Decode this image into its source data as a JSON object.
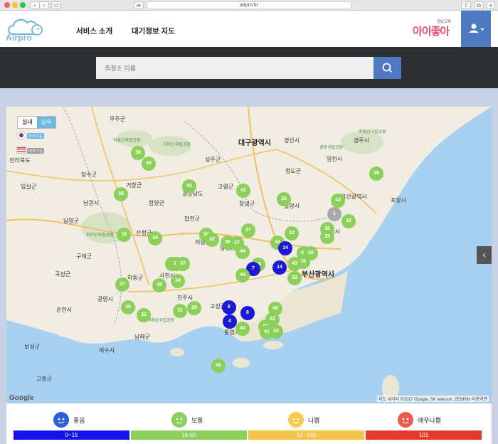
{
  "browser": {
    "url": "airpro.kr"
  },
  "header": {
    "logo_text": "Airpro",
    "nav": [
      "서비스 소개",
      "대기정보 지도"
    ],
    "brand_sub": "경남교육",
    "brand_main": "아이좋아"
  },
  "search": {
    "placeholder": "측정소 이름"
  },
  "map": {
    "tabs": [
      "실내",
      "실외"
    ],
    "active_tab": "실외",
    "time_badges": [
      "한국기준",
      "미국기준"
    ],
    "cities": [
      {
        "name": "대구광역시",
        "big": true
      },
      {
        "name": "부산광역시",
        "big": true
      },
      {
        "name": "울산광역시",
        "big": false
      },
      {
        "name": "경상남도",
        "big": false
      },
      {
        "name": "전라북도",
        "big": false
      },
      {
        "name": "창녕군",
        "big": false
      },
      {
        "name": "경산시",
        "big": false
      },
      {
        "name": "경주시",
        "big": false
      },
      {
        "name": "청도군",
        "big": false
      },
      {
        "name": "밀양시",
        "big": false
      },
      {
        "name": "무주군",
        "big": false
      },
      {
        "name": "장수군",
        "big": false
      },
      {
        "name": "함양군",
        "big": false
      },
      {
        "name": "산청군",
        "big": false
      },
      {
        "name": "구례군",
        "big": false
      },
      {
        "name": "광양시",
        "big": false
      },
      {
        "name": "순천시",
        "big": false
      },
      {
        "name": "여수시",
        "big": false
      },
      {
        "name": "남해군",
        "big": false
      },
      {
        "name": "통영시",
        "big": false
      },
      {
        "name": "고성군",
        "big": false
      },
      {
        "name": "담양군",
        "big": false
      },
      {
        "name": "보성군",
        "big": false
      },
      {
        "name": "고흥군",
        "big": false
      },
      {
        "name": "진주시",
        "big": false
      },
      {
        "name": "사천시",
        "big": false
      },
      {
        "name": "하동군",
        "big": false
      },
      {
        "name": "거창군",
        "big": false
      },
      {
        "name": "합천군",
        "big": false
      },
      {
        "name": "성주군",
        "big": false
      },
      {
        "name": "고령군",
        "big": false
      },
      {
        "name": "의령군",
        "big": false
      },
      {
        "name": "함안군",
        "big": false
      },
      {
        "name": "임실군",
        "big": false
      },
      {
        "name": "남원시",
        "big": false
      },
      {
        "name": "곡성군",
        "big": false
      },
      {
        "name": "양산시",
        "big": false
      },
      {
        "name": "영천시",
        "big": false
      },
      {
        "name": "포항시",
        "big": false
      }
    ],
    "parks": [
      "덕유산국립공원",
      "가야산국립공원",
      "지리산국립공원",
      "한려해상국립공원",
      "경주국립공원",
      "주왕산국립공원"
    ],
    "markers": [
      {
        "v": "38",
        "c": "normal"
      },
      {
        "v": "36",
        "c": "normal"
      },
      {
        "v": "42",
        "c": "normal"
      },
      {
        "v": "38",
        "c": "normal"
      },
      {
        "v": "16",
        "c": "normal"
      },
      {
        "v": "34",
        "c": "normal"
      },
      {
        "v": "42",
        "c": "normal"
      },
      {
        "v": "25",
        "c": "normal"
      },
      {
        "v": "43",
        "c": "normal"
      },
      {
        "v": "26",
        "c": "normal"
      },
      {
        "v": "1",
        "c": "grey"
      },
      {
        "v": "42",
        "c": "normal"
      },
      {
        "v": "30",
        "c": "normal"
      },
      {
        "v": "25",
        "c": "normal"
      },
      {
        "v": "27",
        "c": "normal"
      },
      {
        "v": "34",
        "c": "normal"
      },
      {
        "v": "32",
        "c": "normal"
      },
      {
        "v": "35",
        "c": "normal"
      },
      {
        "v": "27",
        "c": "normal"
      },
      {
        "v": "44",
        "c": "normal"
      },
      {
        "v": "44",
        "c": "normal"
      },
      {
        "v": "12",
        "c": "normal"
      },
      {
        "v": "44",
        "c": "normal"
      },
      {
        "v": "14",
        "c": "good"
      },
      {
        "v": "44",
        "c": "normal"
      },
      {
        "v": "20",
        "c": "normal"
      },
      {
        "v": "18",
        "c": "normal"
      },
      {
        "v": "7",
        "c": "good"
      },
      {
        "v": "14",
        "c": "good"
      },
      {
        "v": "43",
        "c": "normal"
      },
      {
        "v": "44",
        "c": "normal"
      },
      {
        "v": "26",
        "c": "normal"
      },
      {
        "v": "20",
        "c": "normal"
      },
      {
        "v": "37",
        "c": "normal"
      },
      {
        "v": "37",
        "c": "normal"
      },
      {
        "v": "40",
        "c": "normal"
      },
      {
        "v": "34",
        "c": "normal"
      },
      {
        "v": "33",
        "c": "normal"
      },
      {
        "v": "38",
        "c": "normal"
      },
      {
        "v": "32",
        "c": "normal"
      },
      {
        "v": "31",
        "c": "normal"
      },
      {
        "v": "20",
        "c": "normal"
      },
      {
        "v": "6",
        "c": "good"
      },
      {
        "v": "8",
        "c": "good"
      },
      {
        "v": "4",
        "c": "good"
      },
      {
        "v": "45",
        "c": "normal"
      },
      {
        "v": "42",
        "c": "normal"
      },
      {
        "v": "44",
        "c": "normal"
      },
      {
        "v": "43",
        "c": "normal"
      },
      {
        "v": "43",
        "c": "normal"
      },
      {
        "v": "44",
        "c": "normal"
      },
      {
        "v": "42",
        "c": "normal"
      }
    ],
    "attribution": "지도 데이터 ©2017 Google, SK telecom, ZENRIN  이용약관",
    "google_text": "Google"
  },
  "legend": {
    "items": [
      {
        "label": "좋음",
        "range": "0~15",
        "color": "#1414e6",
        "face": "#2b5fd9"
      },
      {
        "label": "보통",
        "range": "16-50",
        "color": "#8ccf5a",
        "face": "#8ccf5a"
      },
      {
        "label": "나쁨",
        "range": "51~100",
        "color": "#f3c44a",
        "face": "#f6c84d"
      },
      {
        "label": "매우나쁨",
        "range": "101",
        "color": "#e53a2b",
        "face": "#ef5a4d"
      }
    ]
  }
}
